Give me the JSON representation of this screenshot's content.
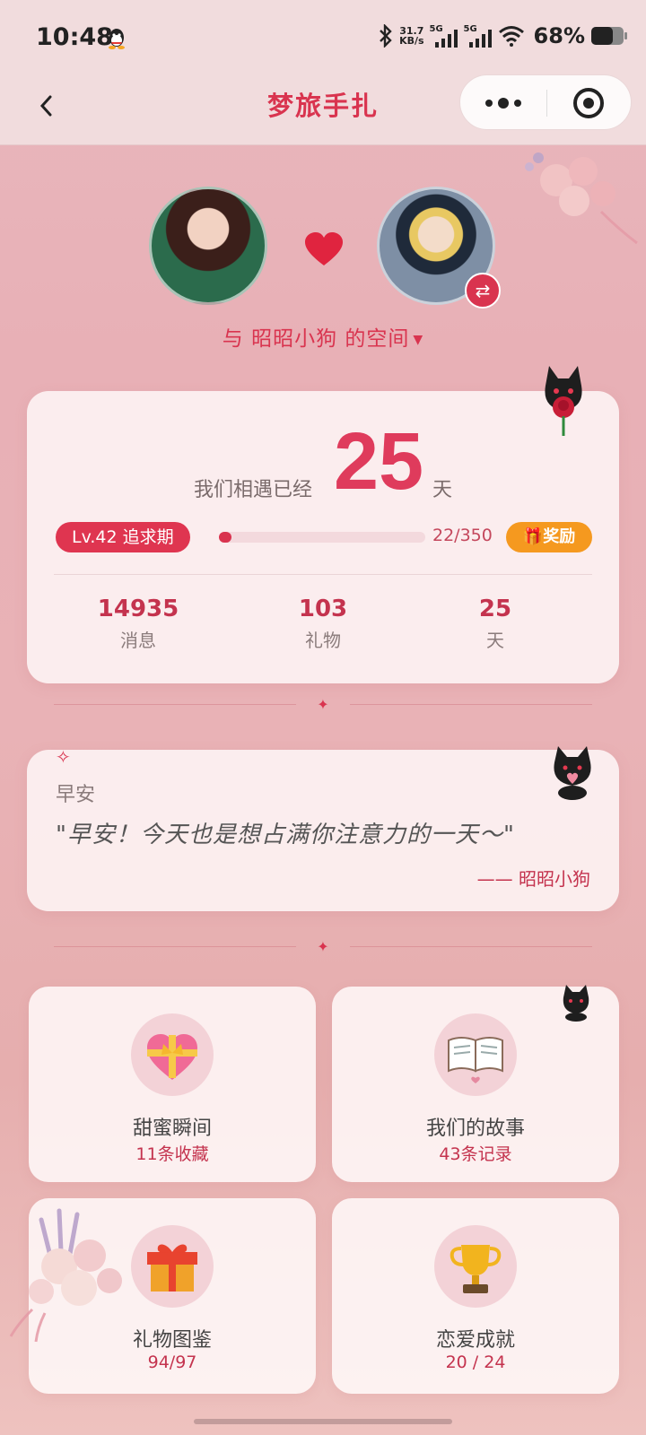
{
  "status_bar": {
    "time": "10:48",
    "net_speed_value": "31.7",
    "net_speed_unit": "KB/s",
    "sim1": "5G",
    "sim2": "5G",
    "battery": "68%"
  },
  "nav": {
    "title": "梦旅手扎"
  },
  "couple": {
    "space_text": "与 昭昭小狗 的空间"
  },
  "stats": {
    "met_label": "我们相遇已经",
    "days": "25",
    "day_unit": "天",
    "level_badge": "Lv.42 追求期",
    "progress_text": "22/350",
    "progress_fraction": 0.063,
    "reward_label": "奖励",
    "items": [
      {
        "num": "14935",
        "label": "消息"
      },
      {
        "num": "103",
        "label": "礼物"
      },
      {
        "num": "25",
        "label": "天"
      }
    ]
  },
  "greeting": {
    "title": "早安",
    "quote": "\"早安！今天也是想占满你注意力的一天～\"",
    "signature": "—— 昭昭小狗"
  },
  "grid": [
    {
      "title": "甜蜜瞬间",
      "sub": "11条收藏",
      "icon": "heart-ribbon-icon"
    },
    {
      "title": "我们的故事",
      "sub": "43条记录",
      "icon": "book-icon"
    },
    {
      "title": "礼物图鉴",
      "sub": "94/97",
      "icon": "gift-icon"
    },
    {
      "title": "恋爱成就",
      "sub": "20 / 24",
      "icon": "trophy-icon"
    }
  ],
  "colors": {
    "accent": "#d9344f",
    "reward": "#f5991f"
  }
}
